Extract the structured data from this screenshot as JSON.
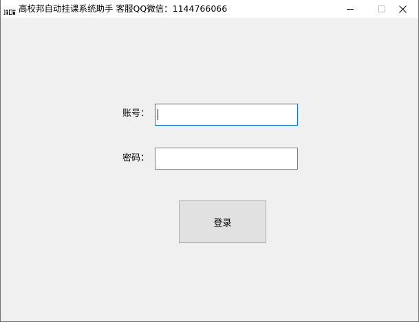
{
  "window": {
    "title": "高校邦自动挂课系统助手 客服QQ微信：1144766066",
    "icon": "app-logo-icon",
    "controls": {
      "minimize": "minimize-icon",
      "maximize": "maximize-icon",
      "close": "close-icon"
    }
  },
  "form": {
    "account_label": "账号：",
    "account_value": "",
    "password_label": "密码：",
    "password_value": "",
    "login_label": "登录"
  },
  "colors": {
    "window_bg": "#f0f0f0",
    "titlebar_bg": "#ffffff",
    "focus_border": "#0078d7",
    "input_border": "#7a7a7a",
    "button_bg": "#e1e1e1",
    "button_border": "#adadad"
  }
}
